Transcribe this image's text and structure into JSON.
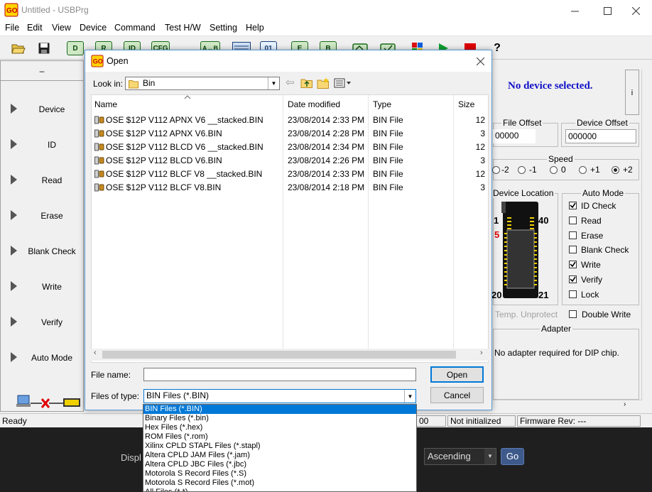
{
  "window": {
    "title": "Untitled - USBPrg",
    "controls": [
      "minimize",
      "maximize",
      "close"
    ]
  },
  "menubar": [
    "File",
    "Edit",
    "View",
    "Device",
    "Command",
    "Test H/W",
    "Setting",
    "Help"
  ],
  "toolbar": {
    "buttons": [
      "open-file-icon",
      "save-icon",
      "device-chip-icon",
      "read-chip-icon",
      "id-chip-icon",
      "cfg-chip-icon",
      "a-b-icon",
      "hex-view-icon",
      "binary-icon",
      "erase-chip-icon",
      "blank-chip-icon",
      "write-chip-icon",
      "verify-chip-icon",
      "color-grid-icon",
      "run-icon",
      "stop-icon",
      "help-icon"
    ],
    "chip_labels": {
      "d": "D",
      "r": "R",
      "id": "ID",
      "cfg": "CFG",
      "ab": "A↔B",
      "bin": "01",
      "e": "E",
      "b": "B"
    },
    "help_label": "?"
  },
  "left_panel": {
    "header": "–",
    "operations": [
      "Device",
      "ID",
      "Read",
      "Erase",
      "Blank Check",
      "Write",
      "Verify",
      "Auto Mode"
    ]
  },
  "right_panel": {
    "device_status": "No device selected.",
    "info_button": "i",
    "file_offset_label": "File Offset",
    "file_offset_value": "00000",
    "device_offset_label": "Device Offset",
    "device_offset_value": "000000",
    "speed_label": "Speed",
    "speed_options": [
      "-2",
      "-1",
      "0",
      "+1",
      "+2"
    ],
    "speed_selected": "+2",
    "device_location_label": "Device Location",
    "pin_labels": {
      "top_left": "1",
      "top_right": "40",
      "bottom_left": "20",
      "bottom_right": "21",
      "marker": "5"
    },
    "temp_unprotect": "Temp. Unprotect",
    "auto_mode_label": "Auto Mode",
    "auto_mode_options": [
      {
        "label": "ID Check",
        "checked": true
      },
      {
        "label": "Read",
        "checked": false
      },
      {
        "label": "Erase",
        "checked": false
      },
      {
        "label": "Blank Check",
        "checked": false
      },
      {
        "label": "Write",
        "checked": true
      },
      {
        "label": "Verify",
        "checked": true
      },
      {
        "label": "Lock",
        "checked": false
      }
    ],
    "double_write_label": "Double Write",
    "adapter_label": "Adapter",
    "adapter_text": "No adapter required for DIP chip."
  },
  "statusbar": {
    "ready": "Ready",
    "count": "00",
    "init_status": "Not initialized",
    "firmware": "Firmware Rev: ---"
  },
  "dark_strip": {
    "partial_label": "Displ",
    "sort_value": "Ascending",
    "go_label": "Go"
  },
  "dialog": {
    "title": "Open",
    "look_in_label": "Look in:",
    "look_in_value": "Bin",
    "columns": [
      "Name",
      "Date modified",
      "Type",
      "Size"
    ],
    "files": [
      {
        "name": "OSE $12P V112 APNX V6 __stacked.BIN",
        "date": "23/08/2014 2:33 PM",
        "type": "BIN File",
        "size": "12"
      },
      {
        "name": "OSE $12P V112 APNX V6.BIN",
        "date": "23/08/2014 2:28 PM",
        "type": "BIN File",
        "size": "3"
      },
      {
        "name": "OSE $12P V112 BLCD V6 __stacked.BIN",
        "date": "23/08/2014 2:34 PM",
        "type": "BIN File",
        "size": "12"
      },
      {
        "name": "OSE $12P V112 BLCD V6.BIN",
        "date": "23/08/2014 2:26 PM",
        "type": "BIN File",
        "size": "3"
      },
      {
        "name": "OSE $12P V112 BLCF V8 __stacked.BIN",
        "date": "23/08/2014 2:33 PM",
        "type": "BIN File",
        "size": "12"
      },
      {
        "name": "OSE $12P V112 BLCF V8.BIN",
        "date": "23/08/2014 2:18 PM",
        "type": "BIN File",
        "size": "3"
      }
    ],
    "file_name_label": "File name:",
    "file_name_value": "",
    "files_of_type_label": "Files of type:",
    "files_of_type_value": "BIN Files (*.BIN)",
    "open_button": "Open",
    "cancel_button": "Cancel",
    "type_options": [
      "BIN Files (*.BIN)",
      "Binary Files (*.bin)",
      "Hex Files (*.hex)",
      "ROM Files (*.rom)",
      "Xilinx CPLD STAPL Files (*.stapl)",
      "Altera CPLD JAM Files (*.jam)",
      "Altera CPLD JBC Files (*.jbc)",
      "Motorola S Record Files (*.S)",
      "Motorola S Record Files (*.mot)",
      "All Files (*.*)"
    ]
  }
}
